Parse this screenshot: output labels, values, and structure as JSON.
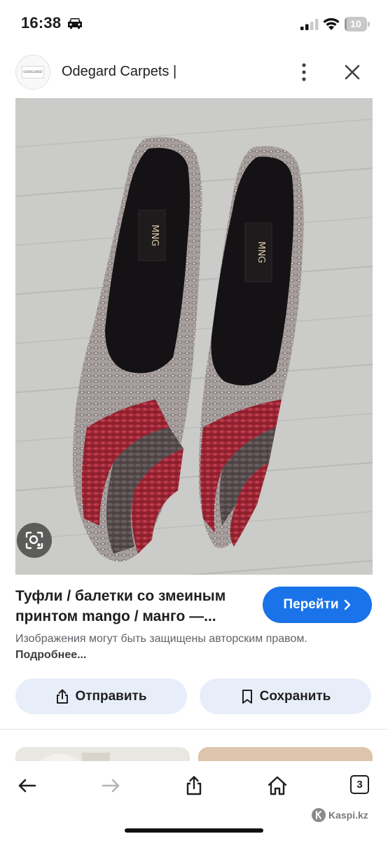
{
  "status_bar": {
    "time": "16:38",
    "battery_level": "10",
    "battery_fraction": 0.1
  },
  "header": {
    "source_title": "Odegard Carpets |",
    "logo_text": "ODEGARD"
  },
  "image": {
    "brand_label_left": "MNG",
    "brand_label_right": "MNG",
    "floor_color": "#c9c9c7",
    "snake_red": "#9e2a37",
    "snake_grey": "#8b8483"
  },
  "result": {
    "title": "Туфли / балетки со змеиным принтом mango / манго —...",
    "visit_label": "Перейти",
    "copyright_text": "Изображения могут быть защищены авторским правом.",
    "copyright_link": "Подробнее..."
  },
  "actions": {
    "share_label": "Отправить",
    "save_label": "Сохранить"
  },
  "toolbar": {
    "tabs_count": "3"
  },
  "watermark": {
    "text": "Kaspi.kz"
  },
  "colors": {
    "accent": "#1a73e8",
    "action_bg": "#e8eef9"
  }
}
